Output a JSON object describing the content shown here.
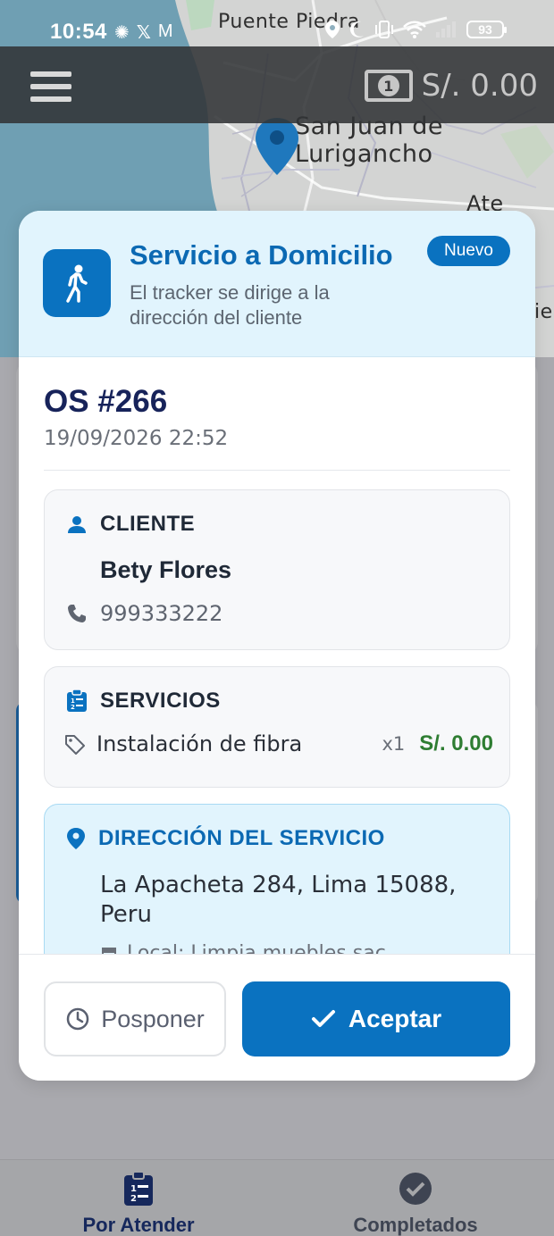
{
  "status_bar": {
    "time": "10:54",
    "left_icons": [
      "openai-icon",
      "x-icon",
      "gmail-icon"
    ],
    "battery": "93"
  },
  "map": {
    "labels": {
      "puente_piedra": "Puente Piedra",
      "san_juan": "San Juan de Lurigancho",
      "ate": "Ate",
      "partial": "ie"
    }
  },
  "top_bar": {
    "balance": "S/. 0.00"
  },
  "modal": {
    "header": {
      "title": "Servicio a Domicilio",
      "subtitle": "El tracker se dirige a la dirección del cliente",
      "badge": "Nuevo"
    },
    "order": {
      "number": "OS #266",
      "datetime": "19/09/2026 22:52"
    },
    "client": {
      "heading": "CLIENTE",
      "name": "Bety Flores",
      "phone": "999333222"
    },
    "services": {
      "heading": "SERVICIOS",
      "items": [
        {
          "name": "Instalación de fibra",
          "qty": "x1",
          "price": "S/. 0.00"
        }
      ]
    },
    "address": {
      "heading": "DIRECCIÓN DEL SERVICIO",
      "text": "La Apacheta 284, Lima 15088, Peru",
      "local": "Local: Limpia muebles sac"
    },
    "actions": {
      "postpone": "Posponer",
      "accept": "Aceptar"
    }
  },
  "bottom_nav": {
    "items": [
      {
        "label": "Por Atender",
        "icon": "clipboard-list-icon",
        "active": true
      },
      {
        "label": "Completados",
        "icon": "check-circle-icon",
        "active": false
      }
    ]
  },
  "colors": {
    "primary": "#0a72c0",
    "header_bg": "#e1f4fd",
    "price_green": "#2e7d32",
    "order_navy": "#17235a"
  }
}
